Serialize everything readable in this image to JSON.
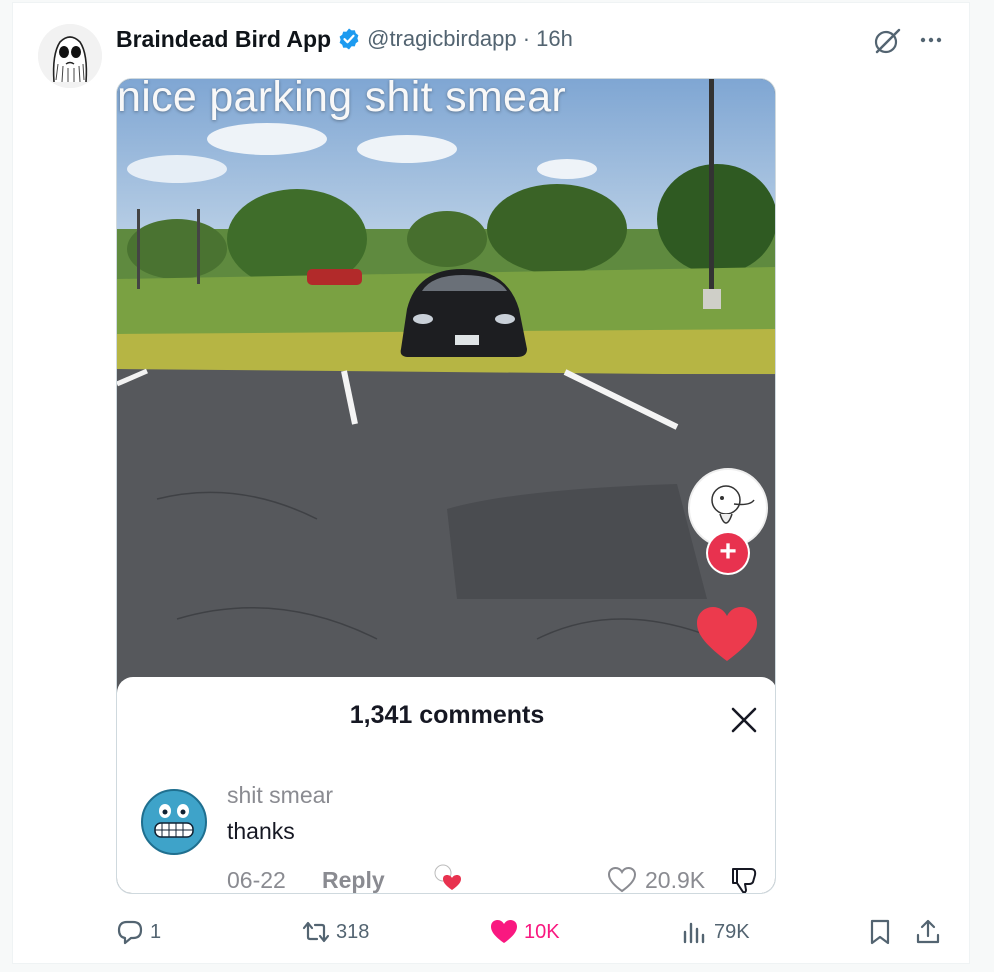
{
  "tweet": {
    "author_name": "Braindead Bird App",
    "handle_time": "@tragicbirdapp · 16h",
    "avatar_icon": "sketch-ghost-avatar",
    "verified_color": "#1d9bf0"
  },
  "media": {
    "caption": "nice parking shit smear",
    "comments_sheet": {
      "title": "1,341 comments",
      "comment": {
        "username": "shit smear",
        "text": "thanks",
        "date": "06-22",
        "reply_label": "Reply",
        "like_count": "20.9K"
      }
    }
  },
  "actions": {
    "replies": "1",
    "retweets": "318",
    "likes": "10K",
    "views": "79K"
  },
  "colors": {
    "like": "#f91880",
    "tiktok_red": "#e8324f",
    "muted": "#536471"
  }
}
